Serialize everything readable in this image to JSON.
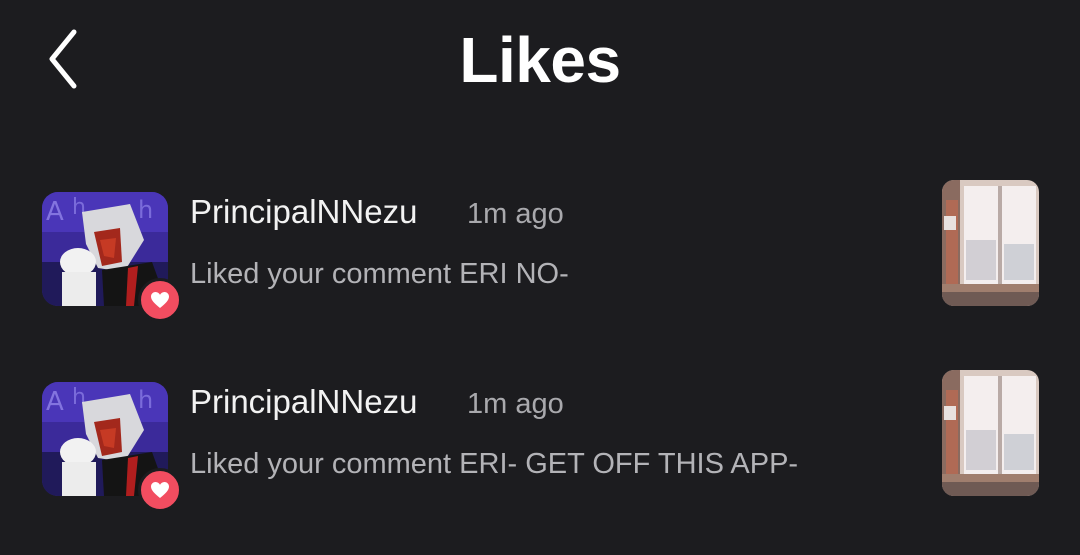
{
  "header": {
    "title": "Likes",
    "back_icon": "chevron-left-icon"
  },
  "colors": {
    "background": "#1c1c1f",
    "heart_badge": "#f24d60",
    "primary_text": "#f2f2f2",
    "secondary_text": "#b3b3b7"
  },
  "notifications": [
    {
      "username": "PrincipalNNezu",
      "time": "1m ago",
      "message": "Liked your comment ERI NO-",
      "badge_icon": "heart-icon"
    },
    {
      "username": "PrincipalNNezu",
      "time": "1m ago",
      "message": "Liked your comment ERI- GET OFF THIS APP-",
      "badge_icon": "heart-icon"
    }
  ]
}
